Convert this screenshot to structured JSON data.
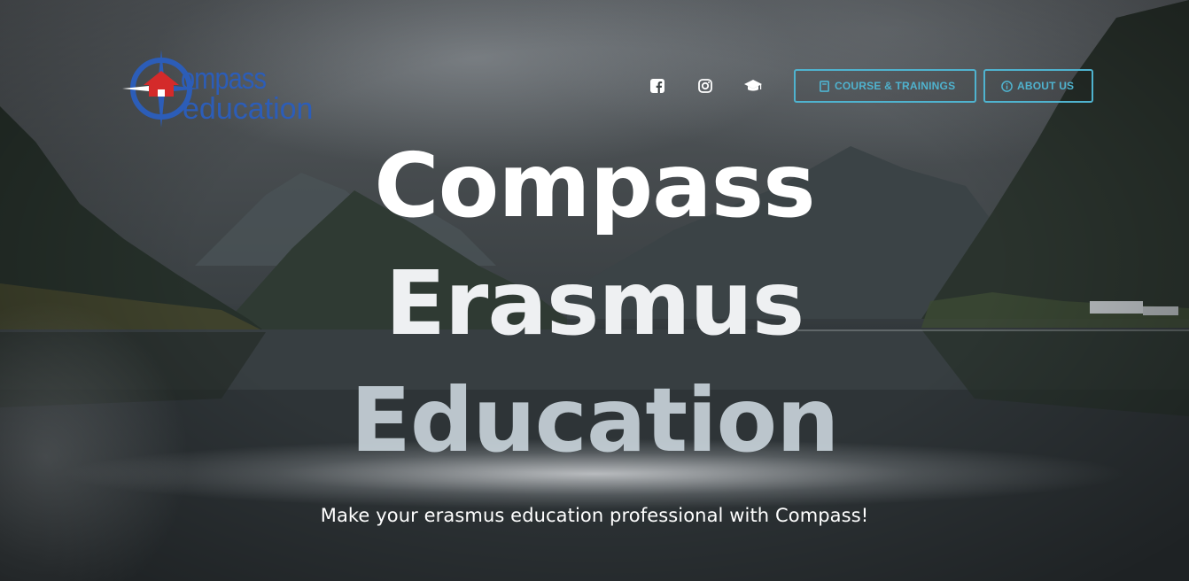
{
  "brand": {
    "logo_line1": "ompass",
    "logo_line2": "education",
    "colors": {
      "blue": "#2c5db8",
      "red": "#d42a2a"
    }
  },
  "nav": {
    "social": [
      {
        "icon": "facebook-icon"
      },
      {
        "icon": "instagram-icon"
      },
      {
        "icon": "graduation-cap-icon"
      }
    ],
    "buttons": [
      {
        "icon": "book-icon",
        "label": "COURSE & TRAININGS"
      },
      {
        "icon": "info-circle-icon",
        "label": "ABOUT US"
      }
    ],
    "accent": "#4fb3cf"
  },
  "hero": {
    "line1": "Compass",
    "line2": "Erasmus",
    "line3": "Education",
    "tagline": "Make your erasmus education professional with Compass!"
  }
}
